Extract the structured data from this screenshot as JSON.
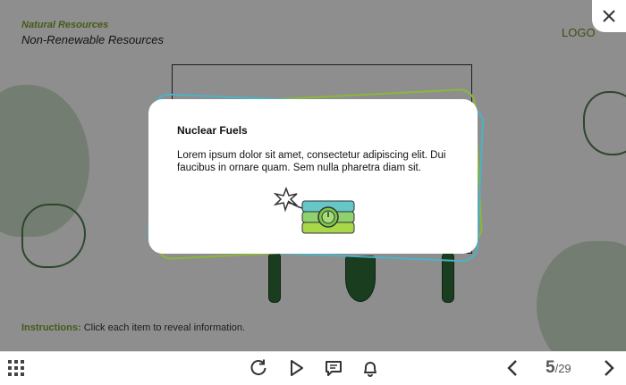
{
  "header": {
    "subject": "Natural Resources",
    "title": "Non-Renewable Resources",
    "logo": "LOGO"
  },
  "instructions": {
    "label": "Instructions:",
    "text": "Click each item to reveal information."
  },
  "popup": {
    "title": "Nuclear Fuels",
    "body": "Lorem ipsum dolor sit amet, consectetur adipiscing elit. Dui faucibus in ornare quam. Sem nulla pharetra diam sit.",
    "image_icon": "dynamite-icon"
  },
  "toolbar": {
    "icons": [
      "menu-grid-icon",
      "replay-icon",
      "play-icon",
      "comment-icon",
      "bell-icon",
      "prev-arrow-icon",
      "next-arrow-icon"
    ],
    "page_current": "5",
    "page_total": "/29"
  },
  "colors": {
    "accent": "#7a9a2e",
    "ring": "#4f7a4e",
    "teal": "#4ab3c6"
  }
}
